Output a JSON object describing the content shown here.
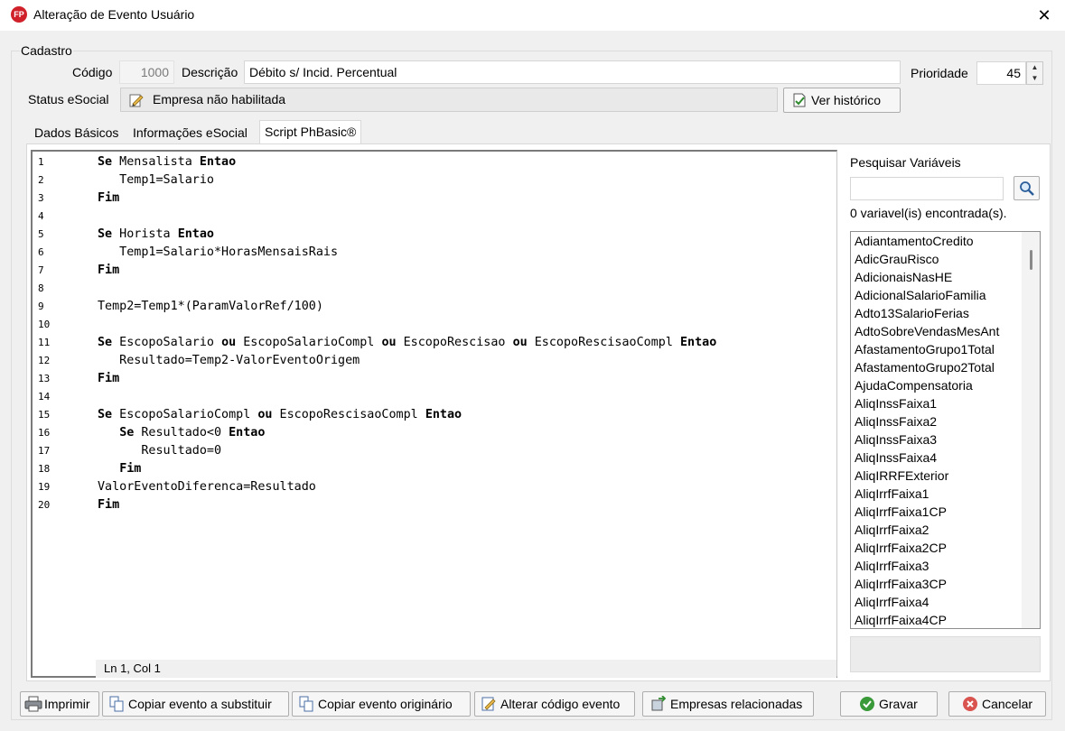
{
  "window": {
    "logo_text": "FP",
    "title": "Alteração de Evento Usuário",
    "close_symbol": "✕"
  },
  "cadastro": {
    "group_label": "Cadastro",
    "codigo_label": "Código",
    "codigo_value": "1000",
    "descricao_label": "Descrição",
    "descricao_value": "Débito s/ Incid. Percentual",
    "prioridade_label": "Prioridade",
    "prioridade_value": "45",
    "status_label": "Status eSocial",
    "status_value": "Empresa não habilitada",
    "ver_historico": "Ver histórico"
  },
  "tabs": [
    {
      "label": "Dados Básicos"
    },
    {
      "label": "Informações eSocial"
    },
    {
      "label": "Script PhBasic®"
    }
  ],
  "editor": {
    "lines": [
      {
        "n": "1",
        "code": [
          {
            "t": "Se",
            "k": true
          },
          {
            "t": " Mensalista "
          },
          {
            "t": "Entao",
            "k": true
          }
        ]
      },
      {
        "n": "2",
        "code": [
          {
            "t": "   Temp1=Salario"
          }
        ]
      },
      {
        "n": "3",
        "code": [
          {
            "t": "Fim",
            "k": true
          }
        ]
      },
      {
        "n": "4",
        "code": []
      },
      {
        "n": "5",
        "code": [
          {
            "t": "Se",
            "k": true
          },
          {
            "t": " Horista "
          },
          {
            "t": "Entao",
            "k": true
          }
        ]
      },
      {
        "n": "6",
        "code": [
          {
            "t": "   Temp1=Salario*HorasMensaisRais"
          }
        ]
      },
      {
        "n": "7",
        "code": [
          {
            "t": "Fim",
            "k": true
          }
        ]
      },
      {
        "n": "8",
        "code": []
      },
      {
        "n": "9",
        "code": [
          {
            "t": "Temp2=Temp1*(ParamValorRef/100)"
          }
        ]
      },
      {
        "n": "10",
        "code": []
      },
      {
        "n": "11",
        "code": [
          {
            "t": "Se",
            "k": true
          },
          {
            "t": " EscopoSalario "
          },
          {
            "t": "ou",
            "k": true
          },
          {
            "t": " EscopoSalarioCompl "
          },
          {
            "t": "ou",
            "k": true
          },
          {
            "t": " EscopoRescisao "
          },
          {
            "t": "ou",
            "k": true
          },
          {
            "t": " EscopoRescisaoCompl "
          },
          {
            "t": "Entao",
            "k": true
          }
        ]
      },
      {
        "n": "12",
        "code": [
          {
            "t": "   Resultado=Temp2-ValorEventoOrigem"
          }
        ]
      },
      {
        "n": "13",
        "code": [
          {
            "t": "Fim",
            "k": true
          }
        ]
      },
      {
        "n": "14",
        "code": []
      },
      {
        "n": "15",
        "code": [
          {
            "t": "Se",
            "k": true
          },
          {
            "t": " EscopoSalarioCompl "
          },
          {
            "t": "ou",
            "k": true
          },
          {
            "t": " EscopoRescisaoCompl "
          },
          {
            "t": "Entao",
            "k": true
          }
        ]
      },
      {
        "n": "16",
        "code": [
          {
            "t": "   "
          },
          {
            "t": "Se",
            "k": true
          },
          {
            "t": " Resultado<0 "
          },
          {
            "t": "Entao",
            "k": true
          }
        ]
      },
      {
        "n": "17",
        "code": [
          {
            "t": "      Resultado=0"
          }
        ]
      },
      {
        "n": "18",
        "code": [
          {
            "t": "   "
          },
          {
            "t": "Fim",
            "k": true
          }
        ]
      },
      {
        "n": "19",
        "code": [
          {
            "t": "ValorEventoDiferenca=Resultado"
          }
        ]
      },
      {
        "n": "20",
        "code": [
          {
            "t": "Fim",
            "k": true
          }
        ]
      }
    ],
    "cursor_position": "Ln 1, Col 1"
  },
  "variables": {
    "search_label": "Pesquisar Variáveis",
    "found_text": "0 variavel(is) encontrada(s).",
    "items": [
      "AdiantamentoCredito",
      "AdicGrauRisco",
      "AdicionaisNasHE",
      "AdicionalSalarioFamilia",
      "Adto13SalarioFerias",
      "AdtoSobreVendasMesAnt",
      "AfastamentoGrupo1Total",
      "AfastamentoGrupo2Total",
      "AjudaCompensatoria",
      "AliqInssFaixa1",
      "AliqInssFaixa2",
      "AliqInssFaixa3",
      "AliqInssFaixa4",
      "AliqIRRFExterior",
      "AliqIrrfFaixa1",
      "AliqIrrfFaixa1CP",
      "AliqIrrfFaixa2",
      "AliqIrrfFaixa2CP",
      "AliqIrrfFaixa3",
      "AliqIrrfFaixa3CP",
      "AliqIrrfFaixa4",
      "AliqIrrfFaixa4CP"
    ]
  },
  "buttons": {
    "imprimir": "Imprimir",
    "copiar_substituir": "Copiar evento a substituir",
    "copiar_originario": "Copiar evento originário",
    "alterar_codigo": "Alterar código evento",
    "empresas": "Empresas relacionadas",
    "gravar": "Gravar",
    "cancelar": "Cancelar"
  },
  "colors": {
    "accent_red": "#d0212a",
    "ok_green": "#3a9a3a",
    "cancel_red": "#d9534f"
  }
}
